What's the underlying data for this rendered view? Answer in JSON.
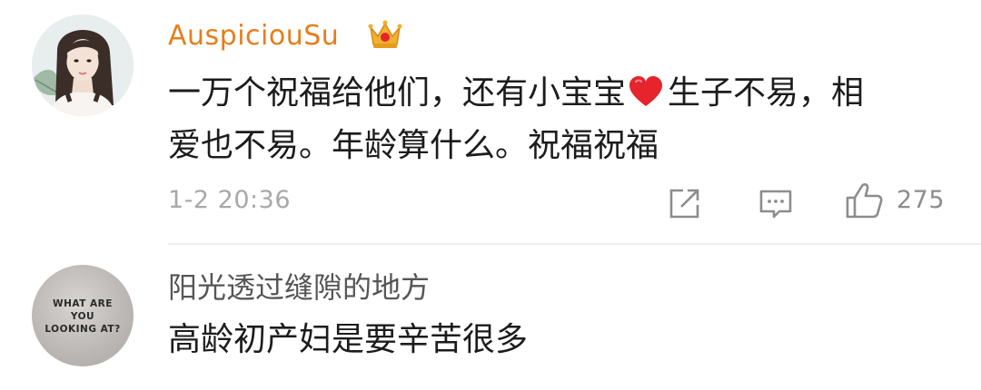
{
  "comments": [
    {
      "username": "AuspiciouSu",
      "badge_icon": "crown-icon",
      "text_line1_before_emoji": "一万个祝福给他们，还有小宝宝",
      "emoji_icon": "red-heart-icon",
      "text_line1_after_emoji": "生子不易，相",
      "text_line2": "爱也不易。年龄算什么。祝福祝福",
      "timestamp": "1-2 20:36",
      "actions": {
        "share_icon": "share-icon",
        "comment_icon": "comment-icon",
        "like_icon": "thumbs-up-icon",
        "like_count": "275"
      }
    },
    {
      "username": "阳光透过缝隙的地方",
      "avatar_text": [
        "WHAT ARE",
        "YOU",
        "LOOKING AT?"
      ],
      "text": "高龄初产妇是要辛苦很多"
    }
  ],
  "colors": {
    "vip_username": "#e57e1b",
    "username": "#555555",
    "comment_text": "#1c1c1c",
    "meta_text": "#a8a8a8",
    "heart": "#e5242c",
    "crown": "#f0b030",
    "divider": "#eeeeee"
  }
}
